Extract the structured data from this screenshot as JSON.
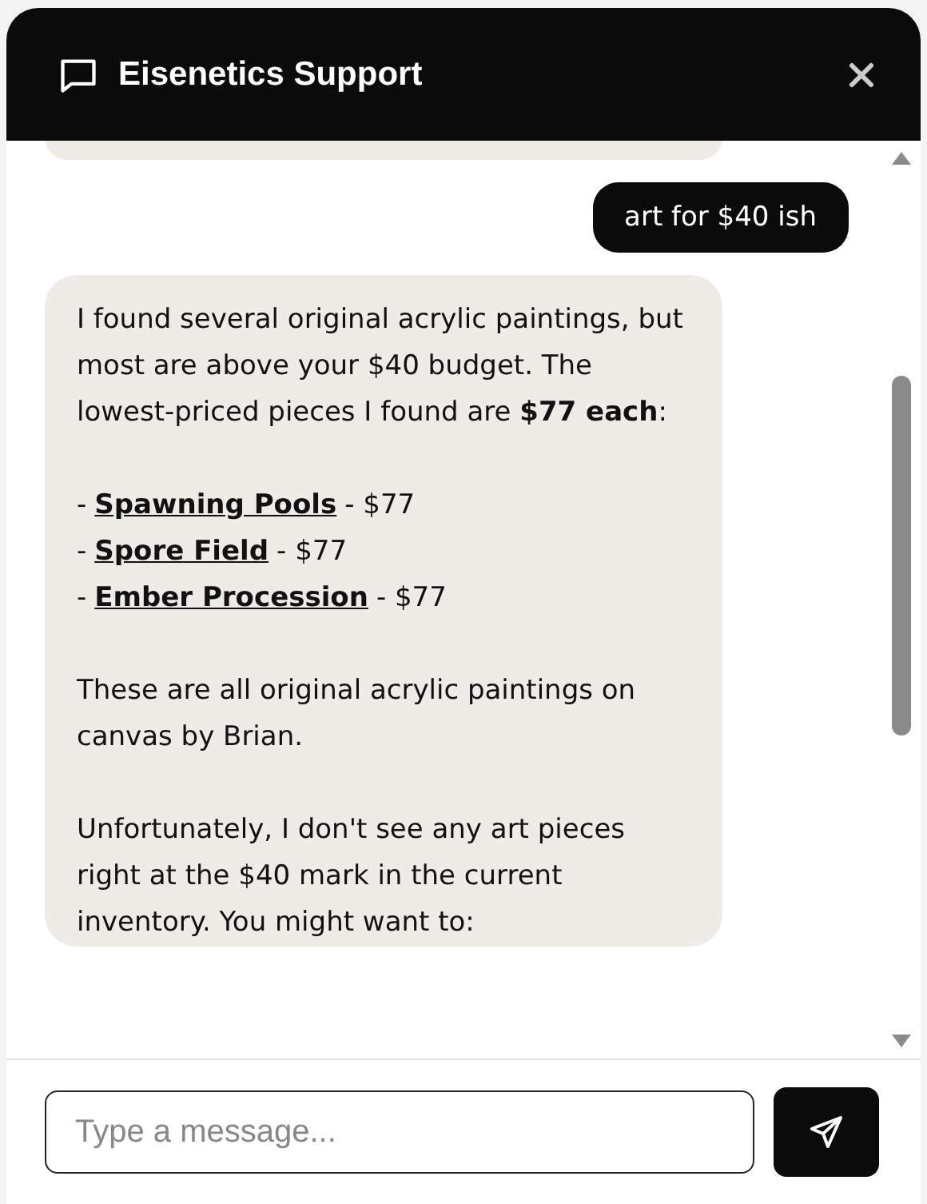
{
  "header": {
    "title": "Eisenetics Support"
  },
  "messages": [
    {
      "kind": "bot"
    },
    {
      "kind": "user",
      "text": "art for $40 ish"
    },
    {
      "kind": "bot",
      "blocks": [
        {
          "kind": "paragraph",
          "text": "I found several original acrylic paintings, but most are above your $40 budget. The lowest-priced pieces I found are **$77 each**:"
        },
        {
          "kind": "list",
          "items": [
            {
              "prefix": "-",
              "link": "Spawning Pools",
              "suffix": "- $77"
            },
            {
              "prefix": "-",
              "link": "Spore Field",
              "suffix": "- $77"
            },
            {
              "prefix": "-",
              "link": "Ember Procession",
              "suffix": "- $77"
            }
          ]
        },
        {
          "kind": "paragraph",
          "text": "These are all original acrylic paintings on canvas by Brian."
        },
        {
          "kind": "paragraph",
          "text": "Unfortunately, I don't see any art pieces right at the $40 mark in the current inventory. You might want to:"
        }
      ]
    }
  ],
  "composer": {
    "placeholder": "Type a message..."
  }
}
